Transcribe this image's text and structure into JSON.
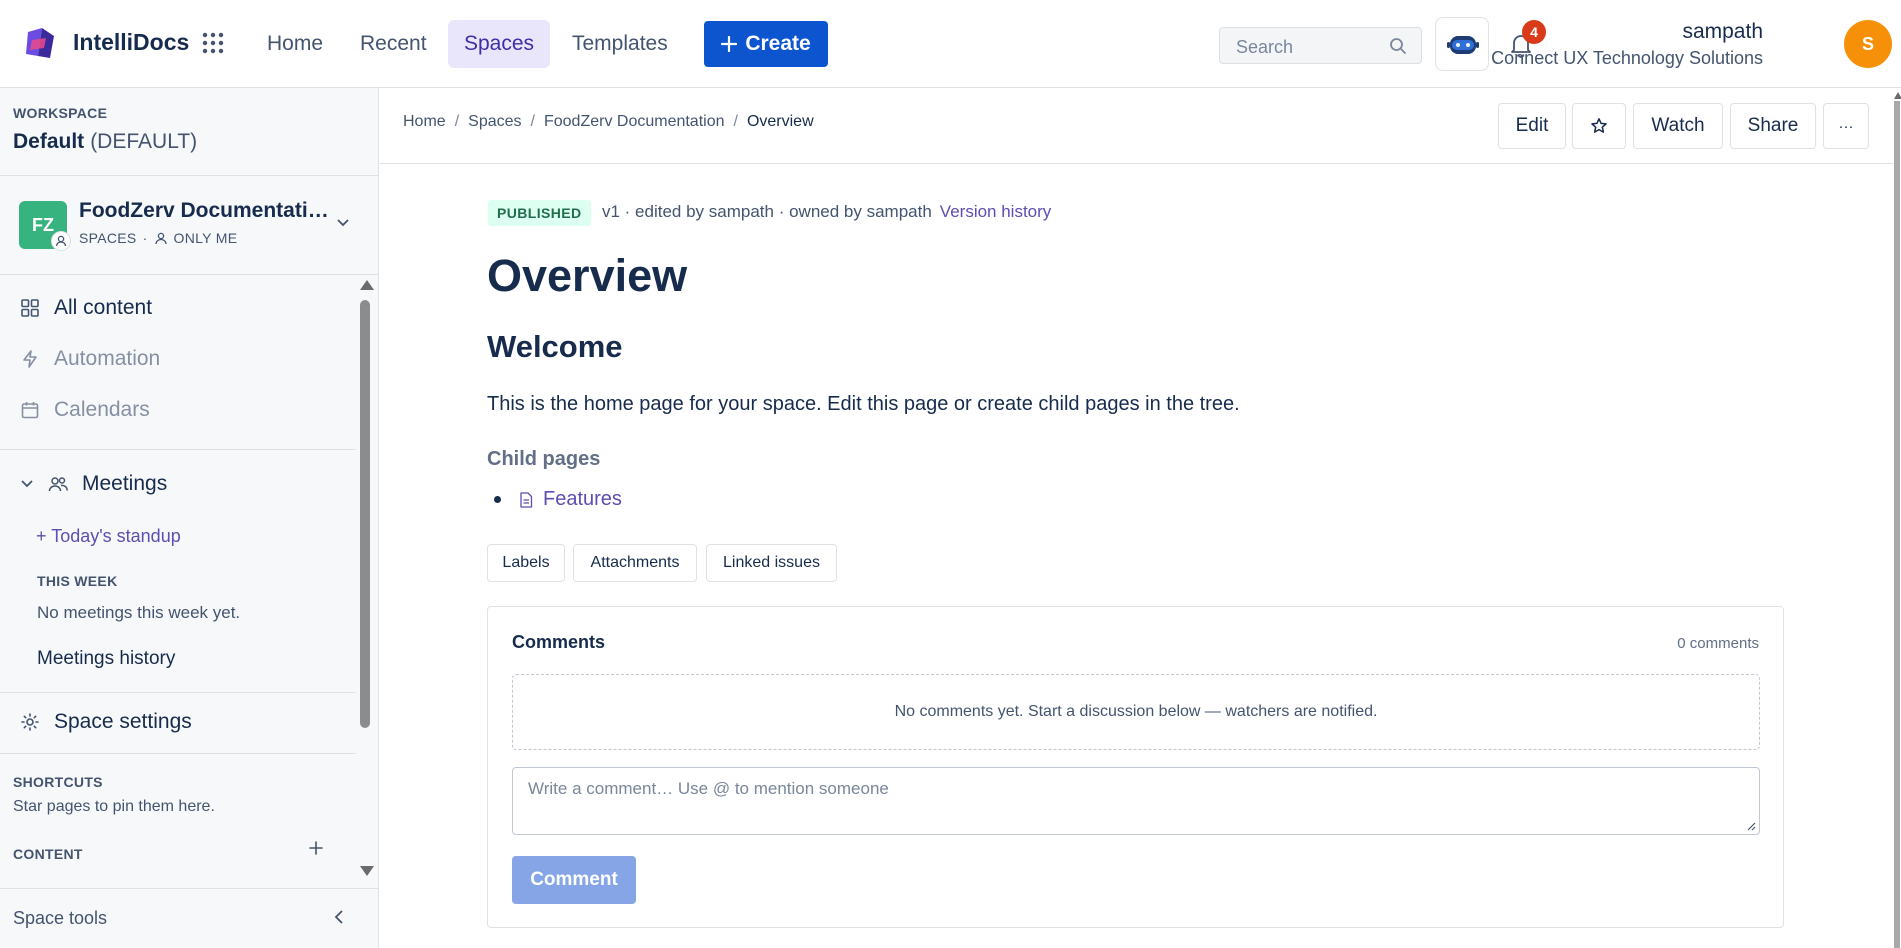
{
  "app": {
    "brand": "IntelliDocs"
  },
  "nav": {
    "home": "Home",
    "recent": "Recent",
    "spaces": "Spaces",
    "templates": "Templates",
    "create": "Create"
  },
  "search": {
    "placeholder": "Search"
  },
  "notifications": {
    "count": "4"
  },
  "user": {
    "name": "sampath",
    "org": "Connect UX Technology Solutions",
    "initial": "S"
  },
  "sidebar": {
    "workspace_label": "WORKSPACE",
    "workspace_name": "Default",
    "workspace_tag": "(DEFAULT)",
    "space": {
      "initials": "FZ",
      "name": "FoodZerv Documentation",
      "type": "SPACES",
      "visibility": "ONLY ME"
    },
    "items": [
      {
        "label": "All content"
      },
      {
        "label": "Automation"
      },
      {
        "label": "Calendars"
      }
    ],
    "meetings": {
      "label": "Meetings",
      "standup": "+ Today's standup",
      "this_week_label": "THIS WEEK",
      "no_meetings": "No meetings this week yet.",
      "history": "Meetings history"
    },
    "space_settings": "Space settings",
    "shortcuts_label": "SHORTCUTS",
    "shortcuts_text": "Star pages to pin them here.",
    "content_label": "CONTENT",
    "space_tools": "Space tools"
  },
  "breadcrumb": {
    "home": "Home",
    "spaces": "Spaces",
    "space": "FoodZerv Documentation",
    "current": "Overview"
  },
  "actions": {
    "edit": "Edit",
    "watch": "Watch",
    "share": "Share",
    "more": "···"
  },
  "page": {
    "status": "PUBLISHED",
    "meta": "v1 · edited by sampath · owned by sampath",
    "version_history": "Version history",
    "title": "Overview",
    "heading": "Welcome",
    "paragraph": "This is the home page for your space. Edit this page or create child pages in the tree.",
    "child_pages_label": "Child pages",
    "child_pages": [
      {
        "title": "Features"
      }
    ]
  },
  "tags": {
    "labels": "Labels",
    "attachments": "Attachments",
    "linked_issues": "Linked issues"
  },
  "comments": {
    "title": "Comments",
    "count": "0 comments",
    "empty": "No comments yet. Start a discussion below — watchers are notified.",
    "placeholder": "Write a comment… Use @ to mention someone",
    "submit": "Comment"
  },
  "colors": {
    "primary": "#0c55cf",
    "accent_purple": "#5e4db2",
    "space_green": "#36b37e",
    "avatar_orange": "#f79009",
    "badge_red": "#d93a1a"
  }
}
